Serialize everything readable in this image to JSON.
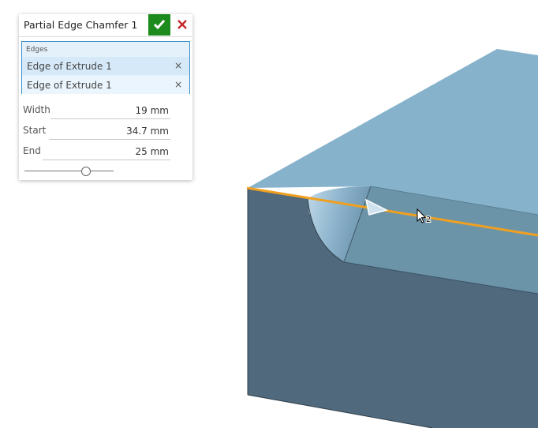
{
  "dialog": {
    "title": "Partial Edge Chamfer 1",
    "edges": {
      "label": "Edges",
      "items": [
        {
          "label": "Edge of Extrude 1",
          "remove": "×"
        },
        {
          "label": "Edge of Extrude 1",
          "remove": "×"
        }
      ]
    },
    "params": {
      "width": {
        "label": "Width",
        "value": "19 mm"
      },
      "start": {
        "label": "Start",
        "value": "34.7 mm"
      },
      "end": {
        "label": "End",
        "value": "25 mm"
      }
    },
    "slider": {
      "value_fraction": 0.69
    }
  },
  "viewport": {
    "cursor_badge": "2"
  },
  "colors": {
    "ok_button": "#1d8a1d",
    "cancel_icon": "#c62828",
    "selection_edge": "#f0a020",
    "face_top": "#86b2cc",
    "face_front": "#50697c",
    "groove_face": "#6d95aa",
    "selection_box": "#3d8ec9"
  }
}
